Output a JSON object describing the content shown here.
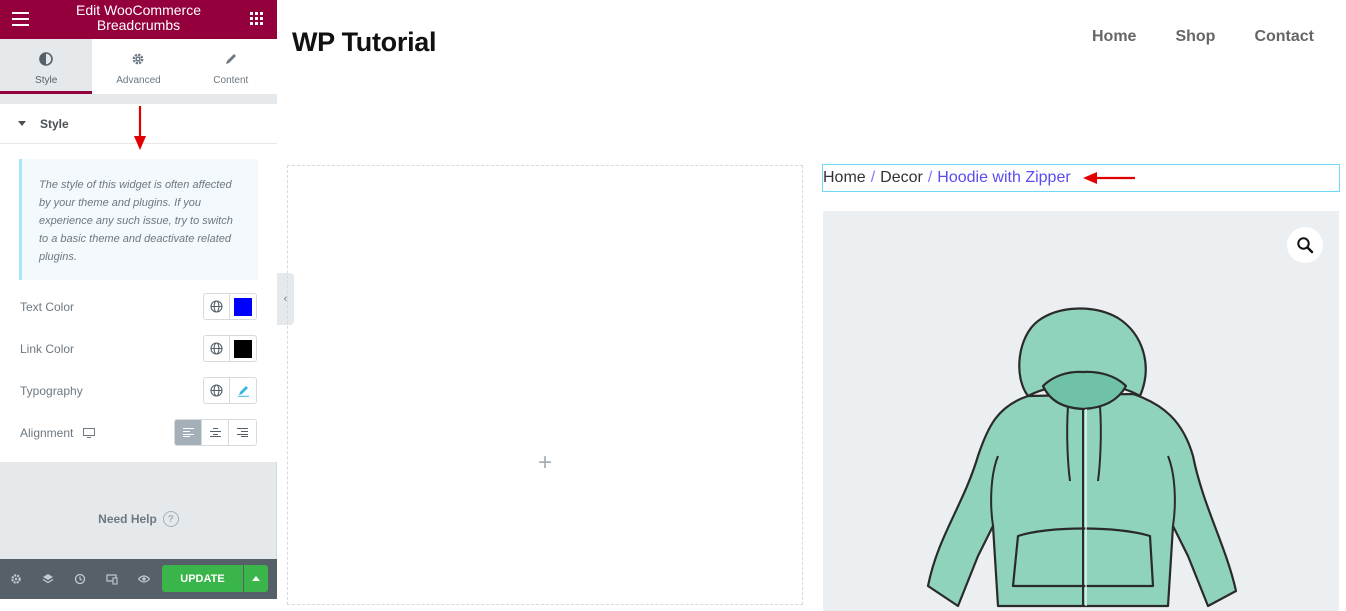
{
  "editor": {
    "title": "Edit WooCommerce Breadcrumbs",
    "tabs": [
      {
        "label": "Style",
        "icon": "half-circle-icon",
        "active": true
      },
      {
        "label": "Advanced",
        "icon": "gear-icon",
        "active": false
      },
      {
        "label": "Content",
        "icon": "pencil-icon",
        "active": false
      }
    ],
    "section_title": "Style",
    "notice": "The style of this widget is often affected by your theme and plugins. If you experience any such issue, try to switch to a basic theme and deactivate related plugins.",
    "controls": {
      "text_color": {
        "label": "Text Color",
        "value": "#0000ff"
      },
      "link_color": {
        "label": "Link Color",
        "value": "#000000"
      },
      "typography": {
        "label": "Typography"
      },
      "alignment": {
        "label": "Alignment",
        "selected": "left"
      }
    },
    "help": "Need Help",
    "update_label": "UPDATE",
    "brand_color": "#93003c",
    "update_color": "#39b54a"
  },
  "site": {
    "title": "WP Tutorial",
    "nav": [
      "Home",
      "Shop",
      "Contact"
    ],
    "breadcrumb": {
      "items": [
        "Home",
        "Decor"
      ],
      "current": "Hoodie with Zipper",
      "separator": "/"
    },
    "empty_placeholder": "+"
  }
}
